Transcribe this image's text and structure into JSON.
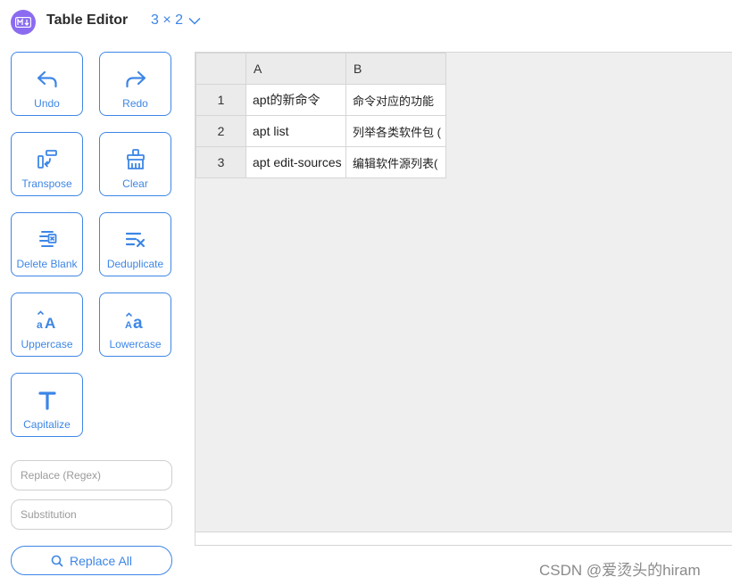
{
  "header": {
    "title": "Table Editor",
    "dimensions": "3 × 2",
    "logo_text": "M↓"
  },
  "colors": {
    "accent": "#3d86e6",
    "logo": "#8b6cf0",
    "header_cells": "#ebebeb",
    "grid_background": "#efefef"
  },
  "toolbar": {
    "undo": "Undo",
    "redo": "Redo",
    "transpose": "Transpose",
    "clear": "Clear",
    "delete_blank": "Delete Blank",
    "deduplicate": "Deduplicate",
    "uppercase": "Uppercase",
    "lowercase": "Lowercase",
    "capitalize": "Capitalize"
  },
  "replace": {
    "regex_placeholder": "Replace (Regex)",
    "substitution_placeholder": "Substitution",
    "button": "Replace All"
  },
  "grid": {
    "columns": [
      "A",
      "B"
    ],
    "rows": [
      {
        "index": "1",
        "cells": [
          "apt的新命令",
          "命令对应的功能"
        ]
      },
      {
        "index": "2",
        "cells": [
          "apt list",
          "列举各类软件包 ("
        ]
      },
      {
        "index": "3",
        "cells": [
          "apt edit-sources",
          "编辑软件源列表("
        ]
      }
    ]
  },
  "watermark": "CSDN @爱烫头的hiram"
}
